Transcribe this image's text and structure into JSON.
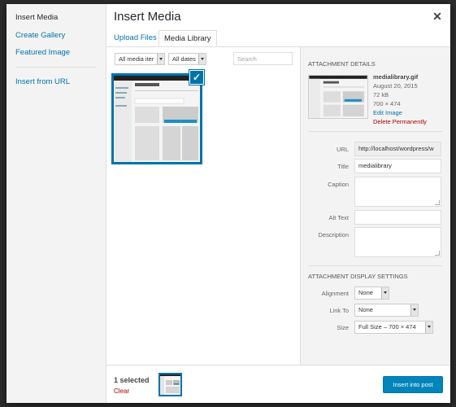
{
  "menu": {
    "items": [
      {
        "label": "Insert Media",
        "active": true
      },
      {
        "label": "Create Gallery",
        "active": false
      },
      {
        "label": "Featured Image",
        "active": false
      },
      {
        "label": "Insert from URL",
        "active": false
      }
    ]
  },
  "header": {
    "title": "Insert Media",
    "close_icon": "close-icon"
  },
  "tabs": [
    {
      "label": "Upload Files",
      "active": false
    },
    {
      "label": "Media Library",
      "active": true
    }
  ],
  "toolbar": {
    "filter_type": {
      "selected": "All media items",
      "shown_text": "All media iter"
    },
    "filter_date": {
      "selected": "All dates"
    },
    "search": {
      "placeholder": "Search",
      "value": ""
    }
  },
  "grid": {
    "items": [
      {
        "filename": "medialibrary.gif",
        "selected": true,
        "check_icon": "checkmark-icon"
      }
    ]
  },
  "details": {
    "heading": "Attachment Details",
    "filename": "medialibrary.gif",
    "date": "August 20, 2015",
    "size": "72 kB",
    "dimensions": "700 × 474",
    "edit_link": "Edit Image",
    "delete_link": "Delete Permanently",
    "fields": {
      "url_label": "URL",
      "url_value": "http://localhost/wordpress/w",
      "title_label": "Title",
      "title_value": "medialibrary",
      "caption_label": "Caption",
      "caption_value": "",
      "alt_label": "Alt Text",
      "alt_value": "",
      "description_label": "Description",
      "description_value": ""
    }
  },
  "display_settings": {
    "heading": "Attachment Display Settings",
    "alignment_label": "Alignment",
    "alignment_value": "None",
    "link_label": "Link To",
    "link_value": "None",
    "size_label": "Size",
    "size_value": "Full Size – 700 × 474"
  },
  "footer": {
    "selected_count": "1 selected",
    "clear_label": "Clear",
    "insert_button": "Insert into post"
  },
  "colors": {
    "accent": "#0073aa",
    "primary_button": "#0085ba",
    "danger": "#aa0000"
  }
}
